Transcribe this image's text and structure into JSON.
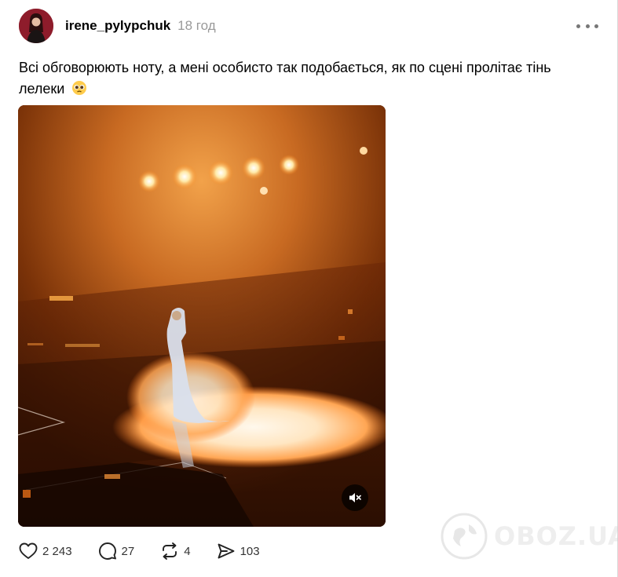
{
  "post": {
    "username": "irene_pylypchuk",
    "time": "18 год",
    "caption": "Всі обговорюють ноту, а мені особисто так подобається, як по сцені пролітає тінь лелеки",
    "emoji": "🥺"
  },
  "icons": {
    "more": "more-horizontal-icon",
    "like": "heart-icon",
    "comment": "speech-bubble-icon",
    "repost": "repost-arrows-icon",
    "share": "send-arrow-icon",
    "mute": "speaker-muted-icon"
  },
  "stats": {
    "likes": "2 243",
    "comments": "27",
    "reposts": "4",
    "shares": "103"
  },
  "watermark": {
    "text": "OBOZ.UA"
  },
  "colors": {
    "time_text": "#999999",
    "count_text": "#333333",
    "stage_glow": "#ff9a2e"
  }
}
